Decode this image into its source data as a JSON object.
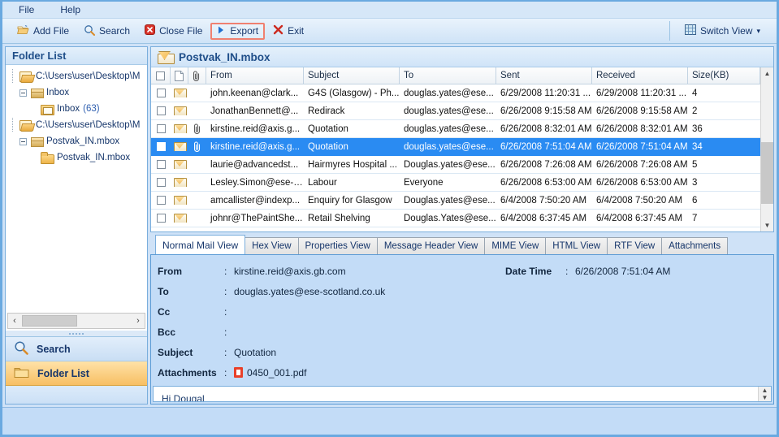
{
  "menubar": {
    "items": [
      {
        "label": "File"
      },
      {
        "label": "Help"
      }
    ]
  },
  "toolbar": {
    "buttons": [
      {
        "label": "Add File",
        "icon": "open-folder-icon"
      },
      {
        "label": "Search",
        "icon": "magnifier-icon"
      },
      {
        "label": "Close File",
        "icon": "close-red-icon"
      },
      {
        "label": "Export",
        "icon": "play-blue-icon",
        "highlighted": true
      },
      {
        "label": "Exit",
        "icon": "x-red-icon"
      }
    ],
    "switch_view": {
      "label": "Switch View",
      "icon": "grid-icon",
      "caret": "▾"
    },
    "highlight_color": "#f08070"
  },
  "sidebar": {
    "title": "Folder List",
    "tree": [
      {
        "label": "C:\\Users\\user\\Desktop\\M",
        "icon": "open-folder-icon",
        "depth": 0,
        "expander": "none"
      },
      {
        "label": "Inbox",
        "icon": "store-icon",
        "depth": 1,
        "expander": "minus"
      },
      {
        "label": "Inbox",
        "count": "(63)",
        "icon": "mail-folder-icon",
        "depth": 2,
        "expander": "none"
      },
      {
        "label": "C:\\Users\\user\\Desktop\\M",
        "icon": "open-folder-icon",
        "depth": 0,
        "expander": "none"
      },
      {
        "label": "Postvak_IN.mbox",
        "icon": "store-icon",
        "depth": 1,
        "expander": "minus"
      },
      {
        "label": "Postvak_IN.mbox",
        "icon": "folder-icon",
        "depth": 2,
        "expander": "none"
      }
    ],
    "hscroll": {
      "left": "‹",
      "right": "›"
    },
    "nav_buttons": [
      {
        "label": "Search",
        "icon": "magnifier-icon",
        "selected": false
      },
      {
        "label": "Folder List",
        "icon": "folder-icon",
        "selected": true
      }
    ]
  },
  "mailbox": {
    "title": "Postvak_IN.mbox",
    "columns": [
      "From",
      "Subject",
      "To",
      "Sent",
      "Received",
      "Size(KB)"
    ],
    "rows": [
      {
        "from": "john.keenan@clark...",
        "subject": "G4S (Glasgow) - Ph...",
        "to": "douglas.yates@ese...",
        "sent": "6/29/2008 11:20:31 ...",
        "received": "6/29/2008 11:20:31 ...",
        "size": "4",
        "attachment": false,
        "selected": false
      },
      {
        "from": "JonathanBennett@...",
        "subject": "Redirack",
        "to": "douglas.yates@ese...",
        "sent": "6/26/2008 9:15:58 AM",
        "received": "6/26/2008 9:15:58 AM",
        "size": "2",
        "attachment": false,
        "selected": false
      },
      {
        "from": "kirstine.reid@axis.g...",
        "subject": "Quotation",
        "to": "douglas.yates@ese...",
        "sent": "6/26/2008 8:32:01 AM",
        "received": "6/26/2008 8:32:01 AM",
        "size": "36",
        "attachment": true,
        "selected": false
      },
      {
        "from": "kirstine.reid@axis.g...",
        "subject": "Quotation",
        "to": "douglas.yates@ese...",
        "sent": "6/26/2008 7:51:04 AM",
        "received": "6/26/2008 7:51:04 AM",
        "size": "34",
        "attachment": true,
        "selected": true
      },
      {
        "from": "laurie@advancedst...",
        "subject": "Hairmyres Hospital ...",
        "to": "Douglas.yates@ese...",
        "sent": "6/26/2008 7:26:08 AM",
        "received": "6/26/2008 7:26:08 AM",
        "size": "5",
        "attachment": false,
        "selected": false
      },
      {
        "from": "Lesley.Simon@ese-s...",
        "subject": "Labour",
        "to": "Everyone",
        "sent": "6/26/2008 6:53:00 AM",
        "received": "6/26/2008 6:53:00 AM",
        "size": "3",
        "attachment": false,
        "selected": false
      },
      {
        "from": "amcallister@indexp...",
        "subject": "Enquiry for Glasgow",
        "to": "Douglas.yates@ese...",
        "sent": "6/4/2008 7:50:20 AM",
        "received": "6/4/2008 7:50:20 AM",
        "size": "6",
        "attachment": false,
        "selected": false
      },
      {
        "from": "johnr@ThePaintShe...",
        "subject": "Retail Shelving",
        "to": "Douglas.Yates@ese...",
        "sent": "6/4/2008 6:37:45 AM",
        "received": "6/4/2008 6:37:45 AM",
        "size": "7",
        "attachment": false,
        "selected": false
      }
    ],
    "selection_color": "#2a8bf2"
  },
  "preview": {
    "tabs": [
      {
        "label": "Normal Mail View",
        "active": true
      },
      {
        "label": "Hex View",
        "active": false
      },
      {
        "label": "Properties View",
        "active": false
      },
      {
        "label": "Message Header View",
        "active": false
      },
      {
        "label": "MIME View",
        "active": false
      },
      {
        "label": "HTML View",
        "active": false
      },
      {
        "label": "RTF View",
        "active": false
      },
      {
        "label": "Attachments",
        "active": false
      }
    ],
    "fields": {
      "from_label": "From",
      "from_value": "kirstine.reid@axis.gb.com",
      "to_label": "To",
      "to_value": "douglas.yates@ese-scotland.co.uk",
      "cc_label": "Cc",
      "cc_value": "",
      "bcc_label": "Bcc",
      "bcc_value": "",
      "subject_label": "Subject",
      "subject_value": "Quotation",
      "attachments_label": "Attachments",
      "attachments_value": "0450_001.pdf",
      "datetime_label": "Date Time",
      "datetime_value": "6/26/2008 7:51:04 AM",
      "colon": ":"
    },
    "body_text": "Hi Dougal"
  }
}
